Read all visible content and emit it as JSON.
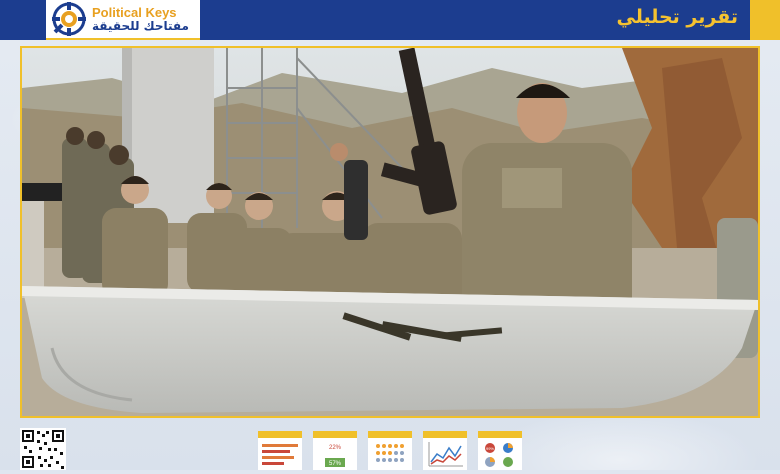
{
  "header": {
    "brand_en": "Political Keys",
    "brand_ar": "مفتاحك للحقيقة",
    "section_title": "تقرير تحليلي",
    "colors": {
      "bar": "#1c3d8f",
      "accent": "#f0c02a",
      "brand_orange": "#e8a020"
    }
  },
  "photo": {
    "icon": "featured-photo"
  },
  "footer": {
    "qr_icon": "qr-code-icon",
    "thumbnails": [
      {
        "icon": "bar-infographic-icon"
      },
      {
        "icon": "percent-infographic-icon",
        "label_top": "22%",
        "label_bottom": "57%"
      },
      {
        "icon": "dot-grid-infographic-icon"
      },
      {
        "icon": "line-infographic-icon"
      },
      {
        "icon": "pie-infographic-icon",
        "label_top": "99%"
      }
    ]
  }
}
